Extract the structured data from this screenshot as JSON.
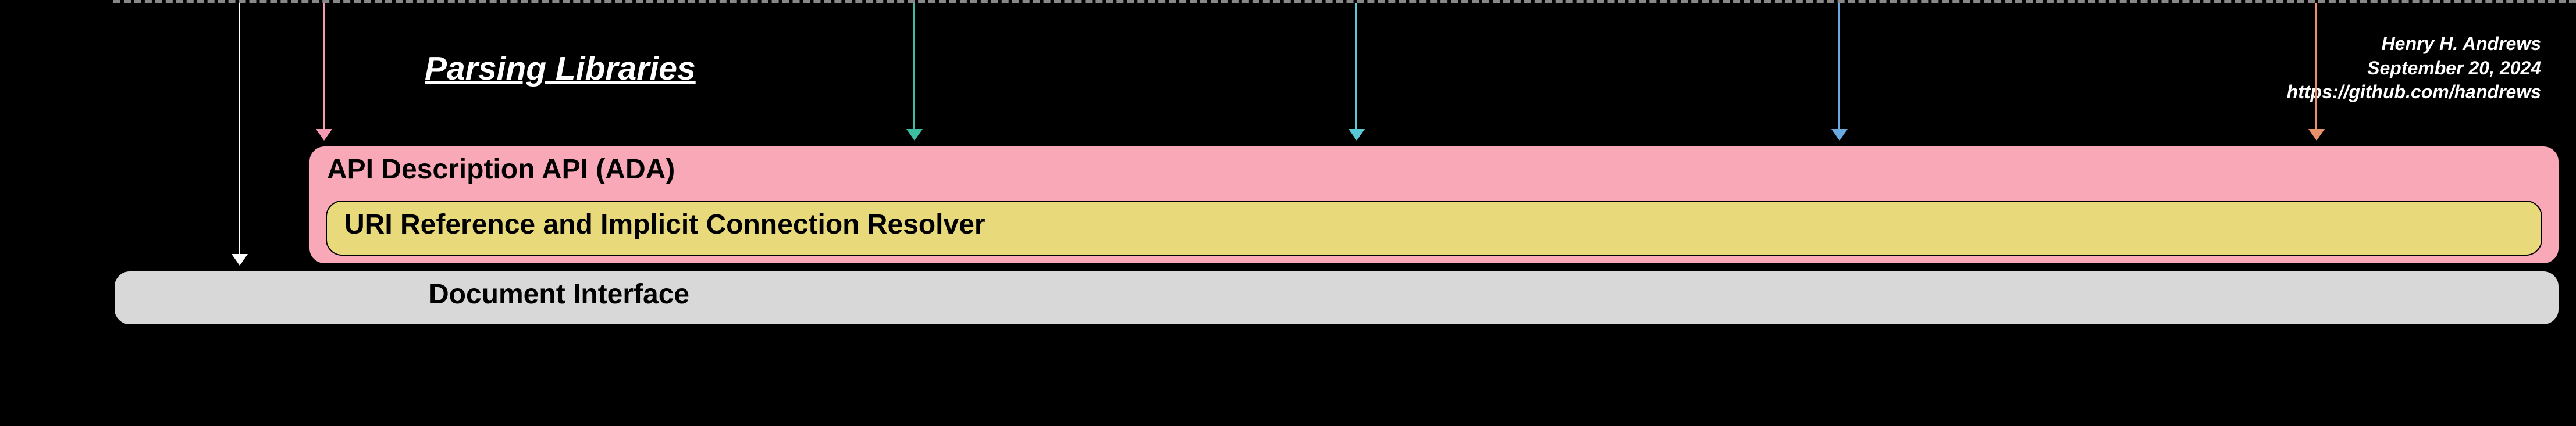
{
  "title": "Parsing Libraries",
  "attribution": {
    "author": "Henry H. Andrews",
    "date": "September 20, 2024",
    "url": "https://github.com/handrews"
  },
  "layers": {
    "ada": "API Description API (ADA)",
    "uri": "URI Reference and Implicit Connection Resolver",
    "doc": "Document Interface"
  },
  "arrows": {
    "white": {
      "color": "#ffffff",
      "target": "document-interface"
    },
    "pink": {
      "color": "#f29bb0",
      "target": "ada"
    },
    "green": {
      "color": "#3cbfa0",
      "target": "ada"
    },
    "cyan": {
      "color": "#5bc8d8",
      "target": "ada"
    },
    "blue": {
      "color": "#6aa8e0",
      "target": "ada"
    },
    "orange": {
      "color": "#e8916a",
      "target": "ada"
    }
  }
}
